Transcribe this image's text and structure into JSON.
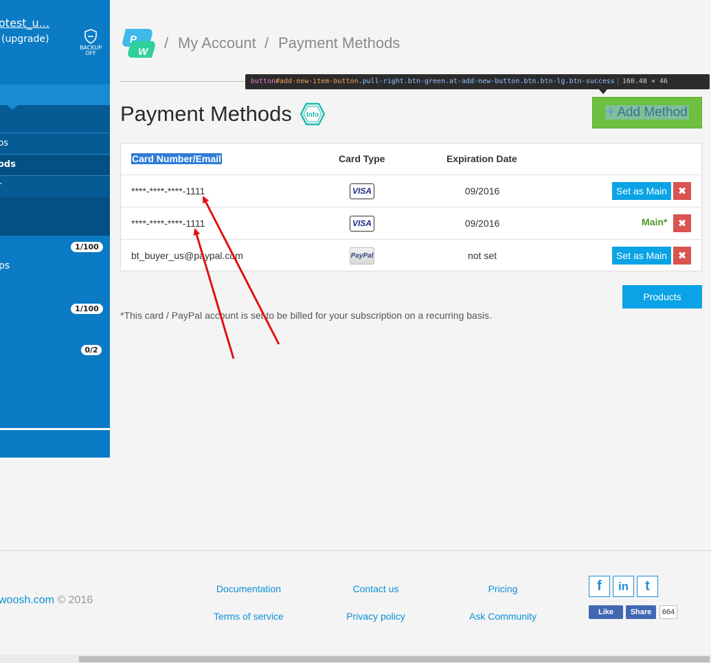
{
  "sidebar": {
    "user_name": "otest_u...",
    "plan": "(upgrade)",
    "backup_label_1": "BACKUP",
    "backup_label_2": "OFF",
    "items": [
      {
        "label": "ps"
      },
      {
        "label": "ods"
      },
      {
        "label": "r"
      }
    ],
    "counters": [
      {
        "label": "ps",
        "value": "1/100"
      },
      {
        "label": "",
        "value": "1/100"
      },
      {
        "label": "",
        "value": "0/2"
      }
    ]
  },
  "breadcrumb": {
    "separator": "/",
    "items": [
      "My Account",
      "Payment Methods"
    ]
  },
  "devtools_tooltip": {
    "tag": "button",
    "id": "#add-new-item-button",
    "classes": ".pull-right.btn-green.at-add-new-button.btn.btn-lg.btn-success",
    "size": "160.48 × 46"
  },
  "page": {
    "title": "Payment Methods",
    "info_label": "Info",
    "add_button": "Add Method",
    "note": "*This card / PayPal account is set to be billed for your subscription on a recurring basis.",
    "products_button": "Products"
  },
  "table": {
    "headers": [
      "Card Number/Email",
      "Card Type",
      "Expiration Date"
    ],
    "rows": [
      {
        "number": "****-****-****-1111",
        "type": "VISA",
        "expiration": "09/2016",
        "action": "Set as Main",
        "delete": "✖"
      },
      {
        "number": "****-****-****-1111",
        "type": "VISA",
        "expiration": "09/2016",
        "action": "Main*",
        "delete": "✖"
      },
      {
        "number": "bt_buyer_us@paypal.com",
        "type": "PayPal",
        "expiration": "not set",
        "action": "Set as Main",
        "delete": "✖"
      }
    ]
  },
  "footer": {
    "copyright_site": "woosh.com",
    "copyright_year": "© 2016",
    "links": [
      "Documentation",
      "Contact us",
      "Pricing",
      "Terms of service",
      "Privacy policy",
      "Ask Community"
    ],
    "social": [
      "f",
      "in",
      "t"
    ],
    "fb_like": "Like",
    "fb_share": "Share",
    "fb_count": "664"
  },
  "colors": {
    "sidebar": "#0a7bc4",
    "add_button": "#6cbf3f",
    "primary_button": "#0aa3e6",
    "danger": "#d9534f",
    "main_label": "#4a9a2a",
    "annotation_arrow": "#e01010"
  }
}
